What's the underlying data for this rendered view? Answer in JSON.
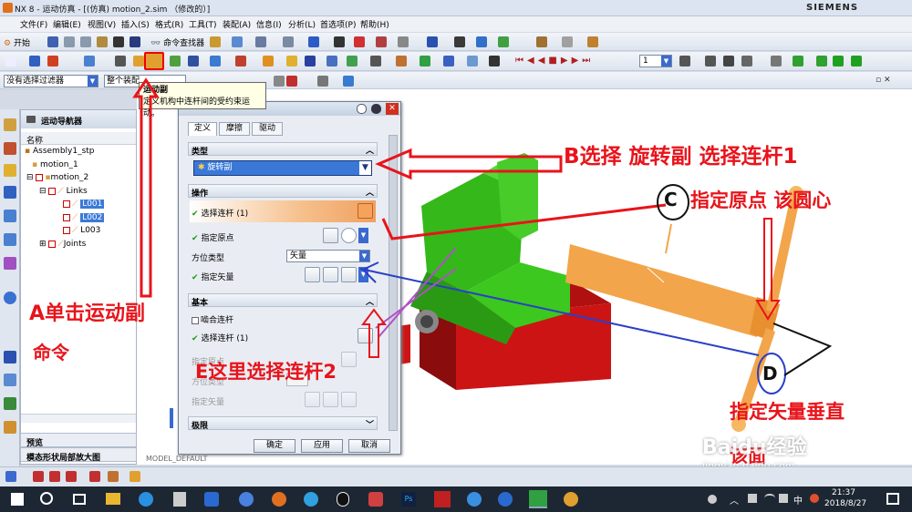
{
  "window": {
    "title": "NX 8 - 运动仿真 - [(仿真) motion_2.sim （修改的）]",
    "brand": "SIEMENS",
    "controls": [
      "_",
      "▫",
      "✕"
    ]
  },
  "menubar": {
    "items": [
      "文件(F)",
      "编辑(E)",
      "视图(V)",
      "插入(S)",
      "格式(R)",
      "工具(T)",
      "装配(A)",
      "信息(I)",
      "分析(L)",
      "首选项(P)",
      "帮助(H)"
    ]
  },
  "toolbar1": {
    "start_label": "开始",
    "command_finder_label": "命令查找器"
  },
  "toolbar2": {
    "frame_value": "1"
  },
  "filterbar": {
    "filter_value": "没有选择过滤器",
    "scope_value": "整个装配"
  },
  "tooltip": {
    "title": "运动副",
    "text": "定义机构中连杆间的受约束运动。"
  },
  "navigator": {
    "title": "运动导航器",
    "column": "名称",
    "tree": [
      {
        "label": "Assembly1_stp",
        "level": 0
      },
      {
        "label": "motion_1",
        "level": 1
      },
      {
        "label": "motion_2",
        "level": 1
      },
      {
        "label": "Links",
        "level": 2
      },
      {
        "label": "L001",
        "level": 3,
        "selected": true
      },
      {
        "label": "L002",
        "level": 3,
        "selected": true
      },
      {
        "label": "L003",
        "level": 3
      },
      {
        "label": "Joints",
        "level": 2
      }
    ],
    "preview_label": "预览",
    "modal_label": "模态形状局部放大图"
  },
  "dialog": {
    "tabs": [
      "定义",
      "摩擦",
      "驱动"
    ],
    "type_section": "类型",
    "type_value": "旋转副",
    "operation_section": "操作",
    "select_link_label": "选择连杆 (1)",
    "specify_origin_label": "指定原点",
    "orientation_type_label": "方位类型",
    "orientation_type_value": "矢量",
    "specify_vector_label": "指定矢量",
    "base_section": "基本",
    "mesh_link_label": "啮合连杆",
    "base_select_link_label": "选择连杆 (1)",
    "base_origin_label": "指定原点",
    "base_orientation_label": "方位类型",
    "base_vector_label": "指定矢量",
    "limits_section": "极限",
    "ok_label": "确定",
    "apply_label": "应用",
    "cancel_label": "取消"
  },
  "annotations": {
    "a": "A单击运动副",
    "a2": "命令",
    "b": "B选择 旋转副 选择连杆1",
    "c_letter": "C",
    "c": "指定原点 该圆心",
    "d_letter": "D",
    "d": "指定矢量垂直",
    "d2": "该面",
    "e": "E这里选择连杆2",
    "model_label": "MODEL_DEFAULT"
  },
  "watermark": {
    "text": "Baidu经验",
    "url": "jingyan.baidu.com"
  },
  "taskbar": {
    "time": "21:37",
    "date": "2018/8/27",
    "ime": "中"
  },
  "colors": {
    "annotation_red": "#e8141b",
    "annotation_blue": "#2a3fc8",
    "annotation_purple": "#b04fc8",
    "model_green": "#3cc81e",
    "model_red": "#cc1414",
    "screw_orange": "#f2a54a"
  }
}
